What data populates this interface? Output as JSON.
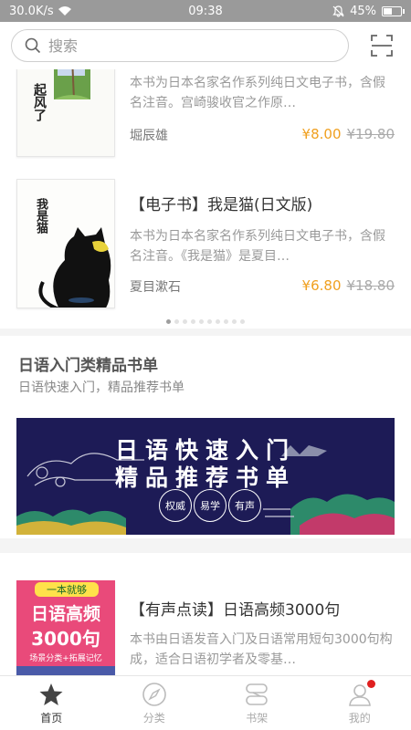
{
  "status_bar": {
    "speed": "30.0K/s",
    "time": "09:38",
    "battery": "45%",
    "battery_level": 0.45
  },
  "search": {
    "placeholder": "搜索"
  },
  "books": [
    {
      "title": "",
      "desc": "本书为日本名家名作系列纯日文电子书，含假名注音。宫崎骏收官之作原…",
      "author": "堀辰雄",
      "price": "¥8.00",
      "old_price": "¥19.80",
      "cover_text": "起风了"
    },
    {
      "title": "【电子书】我是猫(日文版)",
      "desc": "本书为日本名家名作系列纯日文电子书，含假名注音。《我是猫》是夏目…",
      "author": "夏目漱石",
      "price": "¥6.80",
      "old_price": "¥18.80",
      "cover_text": "我是猫"
    },
    {
      "title": "【有声点读】日语高频3000句",
      "desc": "本书由日语发音入门及日语常用短句3000句构成，适合日语初学者及零基…",
      "author": "",
      "price": "",
      "old_price": "",
      "cover_text": "日语高频",
      "cover_sub": "3000句",
      "cover_top": "一本就够",
      "cover_tag": "场景分类+拓展记忆"
    }
  ],
  "carousel": {
    "count": 10,
    "active": 0
  },
  "section": {
    "title": "日语入门类精品书单",
    "subtitle": "日语快速入门，精品推荐书单"
  },
  "banner": {
    "line1": "日语快速入门",
    "line2": "精品推荐书单",
    "seals": [
      "权威",
      "易学",
      "有声"
    ]
  },
  "tabs": [
    {
      "label": "首页",
      "active": true
    },
    {
      "label": "分类",
      "active": false
    },
    {
      "label": "书架",
      "active": false
    },
    {
      "label": "我的",
      "active": false
    }
  ],
  "colors": {
    "price": "#f0a020",
    "banner_bg": "#1d1b56",
    "badge": "#e02020"
  }
}
